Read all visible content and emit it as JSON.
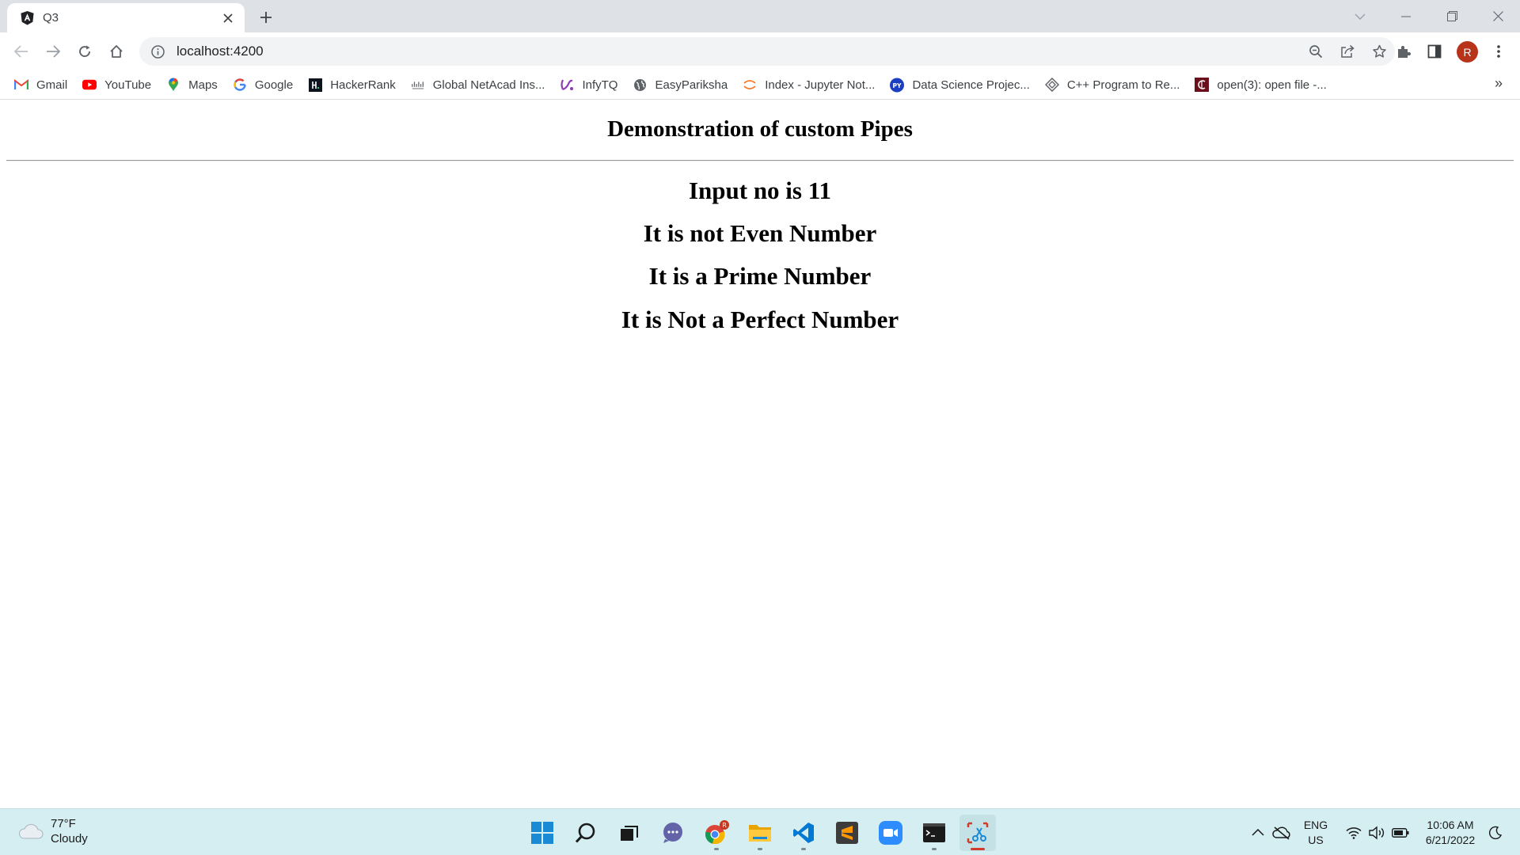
{
  "browser": {
    "tab": {
      "title": "Q3",
      "favicon": "angular-icon"
    },
    "address_bar": {
      "url": "localhost:4200"
    },
    "profile_initial": "R",
    "bookmarks": [
      {
        "label": "Gmail",
        "icon": "gmail-icon"
      },
      {
        "label": "YouTube",
        "icon": "youtube-icon"
      },
      {
        "label": "Maps",
        "icon": "maps-icon"
      },
      {
        "label": "Google",
        "icon": "google-icon"
      },
      {
        "label": "HackerRank",
        "icon": "hackerrank-icon"
      },
      {
        "label": "Global NetAcad Ins...",
        "icon": "cisco-icon"
      },
      {
        "label": "InfyTQ",
        "icon": "infytq-icon"
      },
      {
        "label": "EasyPariksha",
        "icon": "globe-icon"
      },
      {
        "label": "Index - Jupyter Not...",
        "icon": "jupyter-icon"
      },
      {
        "label": "Data Science Projec...",
        "icon": "python-icon"
      },
      {
        "label": "C++ Program to Re...",
        "icon": "diamond-icon"
      },
      {
        "label": "open(3): open file -...",
        "icon": "manpage-icon"
      }
    ],
    "bookmarks_overflow": "»"
  },
  "page": {
    "title": "Demonstration of custom Pipes",
    "lines": [
      "Input no is 11",
      "It is not Even Number",
      "It is a Prime Number",
      "It is Not a Perfect Number"
    ]
  },
  "taskbar": {
    "weather": {
      "temp": "77°F",
      "condition": "Cloudy"
    },
    "chrome_badge": "R",
    "language": {
      "lang": "ENG",
      "region": "US"
    },
    "clock": {
      "time": "10:06 AM",
      "date": "6/21/2022"
    }
  },
  "colors": {
    "tabstrip_bg": "#dee1e6",
    "taskbar_bg": "#d4eef2",
    "profile_avatar": "#b7331a"
  }
}
